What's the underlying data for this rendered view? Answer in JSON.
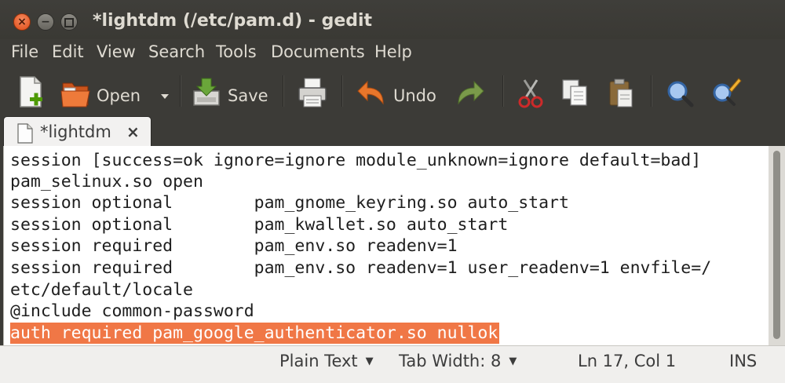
{
  "window": {
    "title": "*lightdm (/etc/pam.d) - gedit",
    "buttons": {
      "close": "×",
      "minimize": "−"
    }
  },
  "menu": [
    "File",
    "Edit",
    "View",
    "Search",
    "Tools",
    "Documents",
    "Help"
  ],
  "toolbar": {
    "open_label": "Open",
    "save_label": "Save",
    "undo_label": "Undo"
  },
  "tab": {
    "label": "*lightdm",
    "close": "×"
  },
  "editor": {
    "lines": [
      "session [success=ok ignore=ignore module_unknown=ignore default=bad]",
      "pam_selinux.so open",
      "session optional        pam_gnome_keyring.so auto_start",
      "session optional        pam_kwallet.so auto_start",
      "session required        pam_env.so readenv=1",
      "session required        pam_env.so readenv=1 user_readenv=1 envfile=/",
      "etc/default/locale",
      "@include common-password",
      "auth required pam_google_authenticator.so nullok"
    ],
    "highlight_color": "#f07746"
  },
  "status": {
    "language": "Plain Text",
    "tab_width": "Tab Width: 8",
    "position": "Ln 17, Col 1",
    "mode": "INS"
  },
  "colors": {
    "titlebar_bg": "#3c3b37",
    "close_button": "#df4b16",
    "editor_bg": "#ffffff",
    "selection": "#f07746"
  }
}
